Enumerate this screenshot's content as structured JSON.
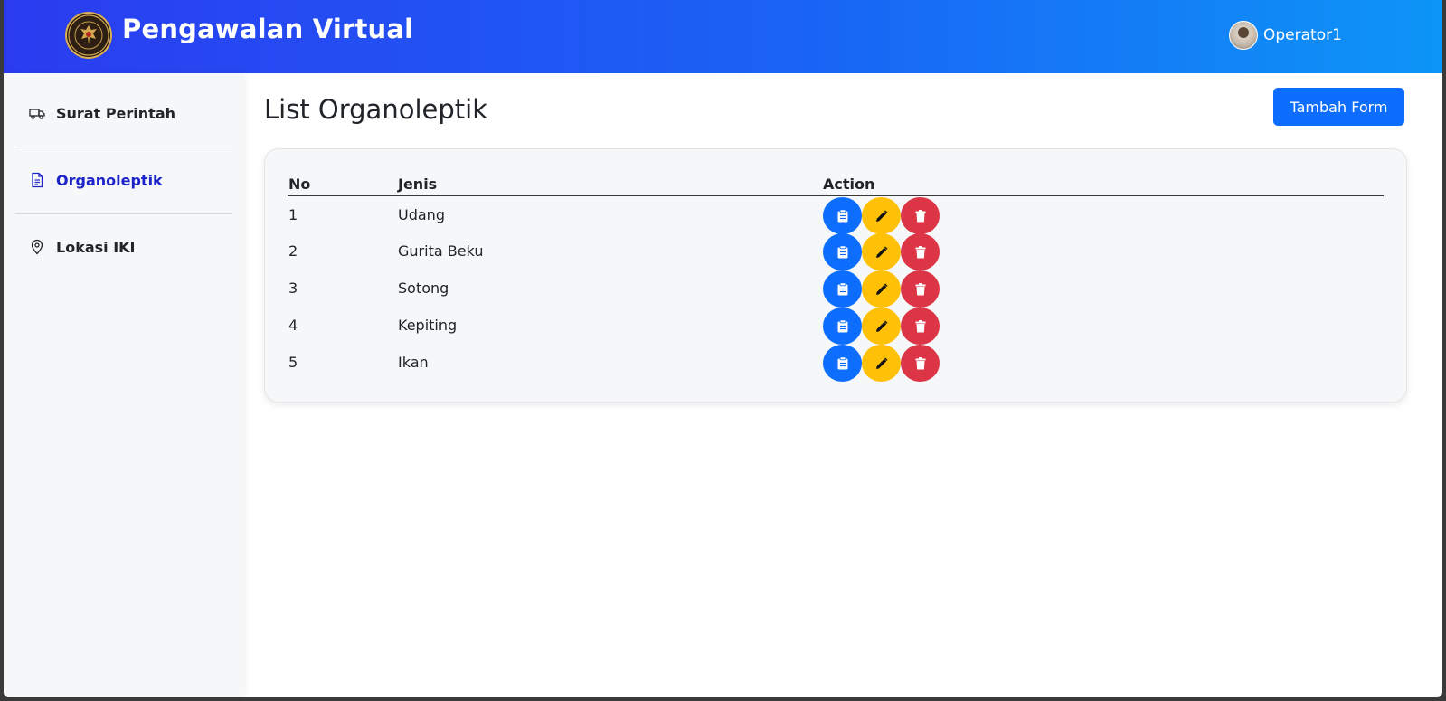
{
  "header": {
    "app_title": "Pengawalan Virtual",
    "user_name": "Operator1"
  },
  "sidebar": {
    "items": [
      {
        "label": "Surat Perintah",
        "icon": "truck-icon",
        "active": false
      },
      {
        "label": "Organoleptik",
        "icon": "document-icon",
        "active": true
      },
      {
        "label": "Lokasi IKI",
        "icon": "map-pin-icon",
        "active": false
      }
    ]
  },
  "main": {
    "title": "List Organoleptik",
    "add_button_label": "Tambah Form",
    "table": {
      "columns": [
        "No",
        "Jenis",
        "Action"
      ],
      "rows": [
        {
          "no": "1",
          "jenis": "Udang"
        },
        {
          "no": "2",
          "jenis": "Gurita Beku"
        },
        {
          "no": "3",
          "jenis": "Sotong"
        },
        {
          "no": "4",
          "jenis": "Kepiting"
        },
        {
          "no": "5",
          "jenis": "Ikan"
        }
      ],
      "actions": [
        "clipboard-icon",
        "pencil-icon",
        "trash-icon"
      ]
    }
  },
  "colors": {
    "primary": "#0d6efd",
    "warning": "#ffc107",
    "danger": "#dc3545",
    "active_nav": "#1d24c9"
  }
}
